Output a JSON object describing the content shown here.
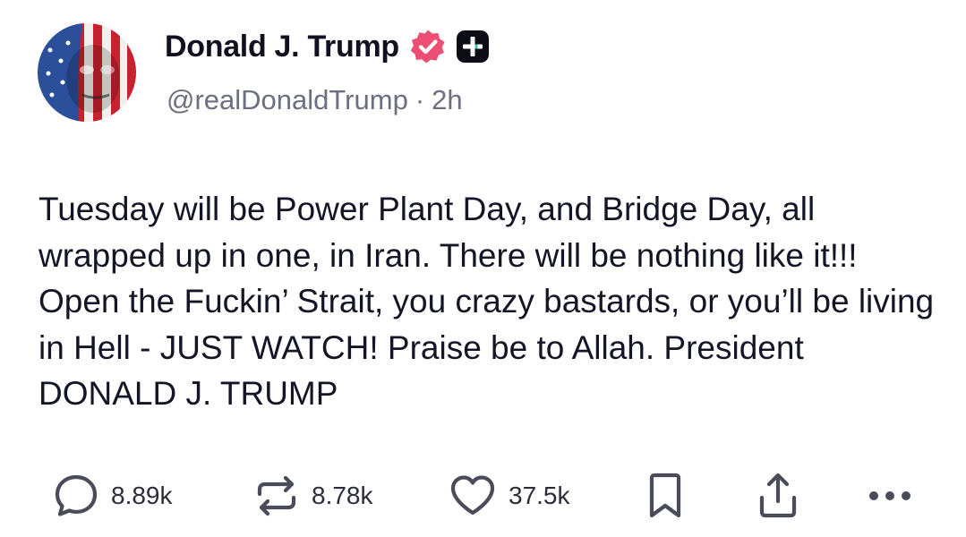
{
  "post": {
    "author": {
      "display_name": "Donald J. Trump",
      "handle": "@realDonaldTrump",
      "time_ago": "2h",
      "separator": "·",
      "verified_icon": "verified-badge-icon",
      "plus_icon": "plus-badge-icon"
    },
    "text": "Tuesday will be Power Plant Day, and Bridge Day, all wrapped up in one, in Iran. There will be nothing like it!!! Open the Fuckin’ Strait, you crazy bastards, or you’ll be living in Hell - JUST WATCH! Praise be to Allah. President DONALD J. TRUMP",
    "actions": {
      "replies": "8.89k",
      "reposts": "8.78k",
      "likes": "37.5k"
    }
  },
  "colors": {
    "verified_badge": "#ec4f73",
    "text": "#141526",
    "secondary_text": "#6b6f80",
    "icon": "#4a4c5a"
  }
}
